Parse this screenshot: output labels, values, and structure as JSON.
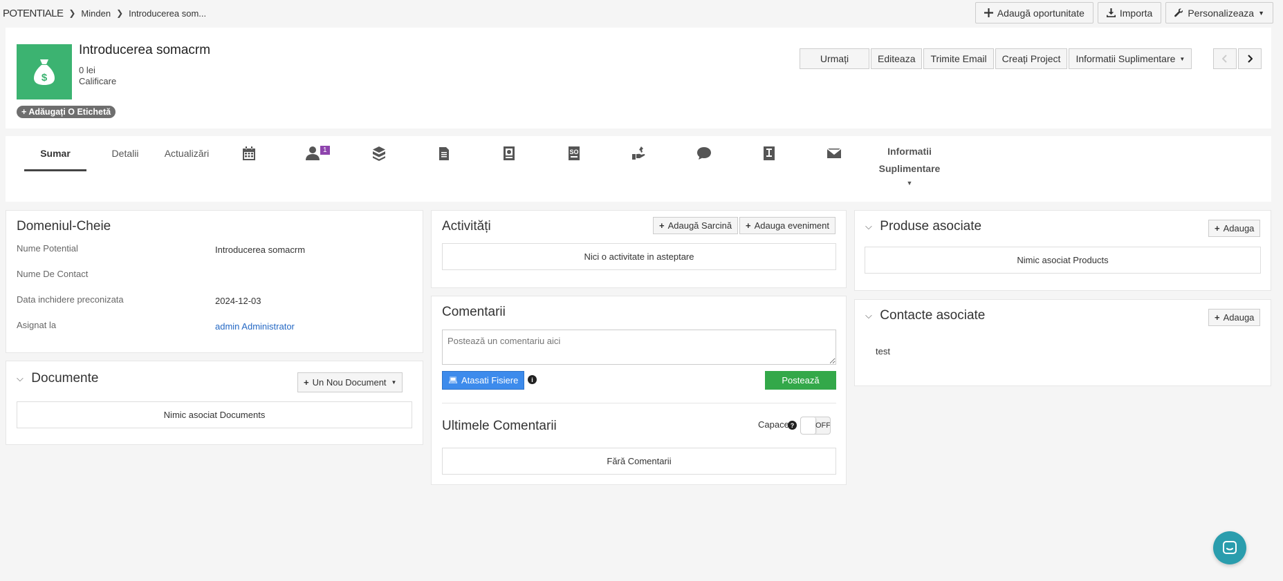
{
  "breadcrumb": {
    "module": "POTENTIALE",
    "parent": "Minden",
    "current": "Introducerea som..."
  },
  "top_actions": {
    "add_opportunity": "Adaugă oportunitate",
    "import": "Importa",
    "customize": "Personalizeaza"
  },
  "record": {
    "title": "Introducerea somacrm",
    "amount": "0 lei",
    "stage": "Calificare",
    "add_tag": "Adăugați O Etichetă",
    "icon_color": "#3cb371"
  },
  "record_actions": {
    "follow": "Urmați",
    "edit": "Editeaza",
    "send_email": "Trimite Email",
    "create_project": "Creați Project",
    "more_info": "Informatii Suplimentare"
  },
  "tabs": {
    "summary": "Sumar",
    "details": "Detalii",
    "updates": "Actualizări",
    "contacts_badge": "1",
    "more_line1": "Informatii",
    "more_line2": "Suplimentare",
    "icons": [
      "calendar-icon",
      "contacts-icon",
      "products-icon",
      "documents-icon",
      "quotes-icon",
      "sales-order-icon",
      "services-icon",
      "comments-icon",
      "invoice-icon",
      "email-icon"
    ]
  },
  "key_fields": {
    "title": "Domeniul-Cheie",
    "rows": [
      {
        "label": "Nume Potential",
        "value": "Introducerea somacrm"
      },
      {
        "label": "Nume De Contact",
        "value": ""
      },
      {
        "label": "Data inchidere preconizata",
        "value": "2024-12-03"
      },
      {
        "label": "Asignat la",
        "value": "admin Administrator"
      }
    ]
  },
  "documents": {
    "title": "Documente",
    "new_button": "Un Nou Document",
    "empty": "Nimic asociat Documents"
  },
  "activities": {
    "title": "Activități",
    "add_task": "Adaugă Sarcină",
    "add_event": "Adauga eveniment",
    "empty": "Nici o activitate in asteptare"
  },
  "comments": {
    "title": "Comentarii",
    "placeholder": "Postează un comentariu aici",
    "attach": "Atasati Fisiere",
    "post": "Postează",
    "recent_title": "Ultimele Comentarii",
    "rollup_label": "Capace",
    "toggle_state": "OFF",
    "empty": "Fără Comentarii"
  },
  "products": {
    "title": "Produse asociate",
    "add": "Adauga",
    "empty": "Nimic asociat Products"
  },
  "contacts": {
    "title": "Contacte asociate",
    "add": "Adauga",
    "items": [
      "test"
    ]
  },
  "colors": {
    "post_button": "#33a849",
    "attach_button": "#3d8bec",
    "link": "#2468c4",
    "badge": "#8e44ad",
    "chat": "#2a9dad"
  }
}
